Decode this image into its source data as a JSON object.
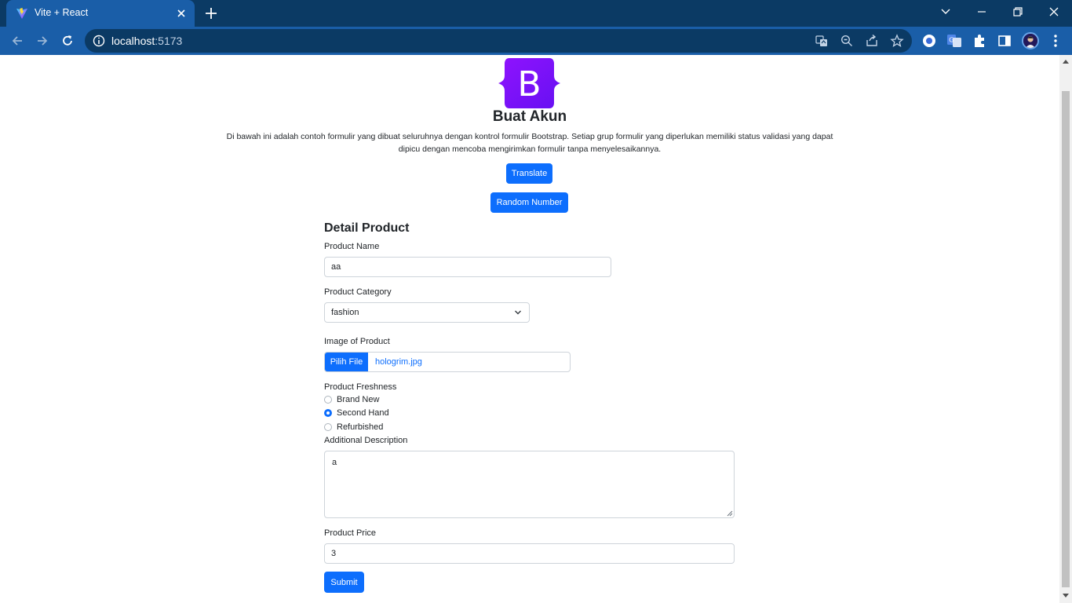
{
  "browser": {
    "tab_title": "Vite + React",
    "url_host": "localhost",
    "url_port": ":5173",
    "accent_color": "#1a5ea8",
    "frame_color": "#0b3a64"
  },
  "page": {
    "title": "Buat Akun",
    "lead": "Di bawah ini adalah contoh formulir yang dibuat seluruhnya dengan kontrol formulir Bootstrap. Setiap grup formulir yang diperlukan memiliki status validasi yang dapat dipicu dengan mencoba mengirimkan formulir tanpa menyelesaikannya.",
    "logo_letter": "B",
    "logo_color": "#8512f7",
    "translate_label": "Translate",
    "random_label": "Random Number"
  },
  "form": {
    "section_title": "Detail Product",
    "product_name_label": "Product Name",
    "product_name_value": "aa",
    "category_label": "Product Category",
    "category_value": "fashion",
    "image_label": "Image of Product",
    "file_button_label": "Pilih File",
    "file_name": "hologrim.jpg",
    "freshness_label": "Product Freshness",
    "freshness_options": [
      "Brand New",
      "Second Hand",
      "Refurbished"
    ],
    "freshness_selected": "Second Hand",
    "description_label": "Additional Description",
    "description_value": "a",
    "price_label": "Product Price",
    "price_value": "3",
    "submit_label": "Submit",
    "primary_color": "#0d6efd"
  },
  "icons": [
    "vite-icon",
    "close-icon",
    "plus-icon",
    "chevron-down-icon",
    "minimize-icon",
    "restore-icon",
    "back-arrow-icon",
    "forward-arrow-icon",
    "reload-icon",
    "info-icon",
    "translate-icon",
    "zoom-icon",
    "share-icon",
    "star-icon",
    "extension-icon",
    "puzzle-icon",
    "sidepanel-icon",
    "more-icon"
  ]
}
